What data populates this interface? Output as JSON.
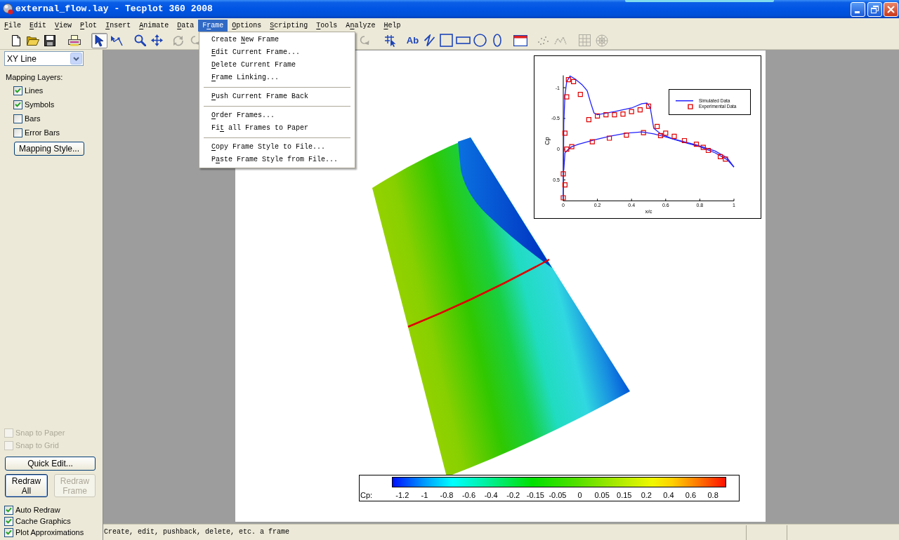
{
  "window": {
    "title": "external_flow.lay - Tecplot 360 2008"
  },
  "menu_bar": [
    {
      "underlined": "F",
      "after": "ile",
      "selected": false
    },
    {
      "underlined": "E",
      "after": "dit",
      "selected": false
    },
    {
      "underlined": "V",
      "after": "iew",
      "selected": false
    },
    {
      "underlined": "P",
      "after": "lot",
      "selected": false
    },
    {
      "underlined": "I",
      "after": "nsert",
      "selected": false
    },
    {
      "underlined": "A",
      "after": "nimate",
      "selected": false
    },
    {
      "underlined": "D",
      "after": "ata",
      "selected": false
    },
    {
      "before": "F",
      "underlined": "r",
      "after": "ame",
      "selected": true
    },
    {
      "underlined": "O",
      "after": "ptions",
      "selected": false
    },
    {
      "underlined": "S",
      "after": "cripting",
      "selected": false
    },
    {
      "underlined": "T",
      "after": "ools",
      "selected": false
    },
    {
      "before": "A",
      "underlined": "n",
      "after": "alyze",
      "selected": false
    },
    {
      "underlined": "H",
      "after": "elp",
      "selected": false
    }
  ],
  "toolbar": [
    {
      "tools": [
        {
          "kind": "new",
          "selected": false,
          "disabled": false
        },
        {
          "kind": "open",
          "selected": false,
          "disabled": false
        },
        {
          "kind": "save",
          "selected": false,
          "disabled": false
        }
      ]
    },
    {
      "tools": [
        {
          "kind": "print",
          "selected": false,
          "disabled": false
        }
      ]
    },
    {
      "tools": [
        {
          "kind": "pointer",
          "selected": true,
          "disabled": false
        },
        {
          "kind": "adjustor",
          "selected": false,
          "disabled": false
        }
      ]
    },
    {
      "tools": [
        {
          "kind": "zoom",
          "selected": false,
          "disabled": false
        },
        {
          "kind": "translate",
          "selected": false,
          "disabled": false
        }
      ]
    },
    {
      "tools": [
        {
          "kind": "rotate",
          "selected": false,
          "disabled": true
        },
        {
          "kind": "spin",
          "selected": false,
          "disabled": true
        }
      ]
    },
    {
      "tools": [
        {
          "kind": "spin",
          "selected": false,
          "disabled": true
        }
      ]
    },
    {
      "tools": [
        {
          "kind": "probe",
          "selected": false,
          "disabled": false
        }
      ]
    },
    {
      "tools": [
        {
          "kind": "text",
          "label": "Ab",
          "selected": false,
          "disabled": false
        },
        {
          "kind": "polyline",
          "selected": false,
          "disabled": false
        },
        {
          "kind": "square",
          "selected": false,
          "disabled": false
        },
        {
          "kind": "rectangle",
          "selected": false,
          "disabled": false
        },
        {
          "kind": "circle",
          "selected": false,
          "disabled": false
        },
        {
          "kind": "ellipse",
          "selected": false,
          "disabled": false
        }
      ]
    },
    {
      "tools": [
        {
          "kind": "frame",
          "selected": false,
          "disabled": false
        }
      ]
    },
    {
      "tools": [
        {
          "kind": "scatter",
          "selected": false,
          "disabled": true
        },
        {
          "kind": "line",
          "selected": false,
          "disabled": true
        }
      ]
    },
    {
      "tools": [
        {
          "kind": "grid",
          "selected": false,
          "disabled": true
        },
        {
          "kind": "polar",
          "selected": false,
          "disabled": true
        }
      ]
    }
  ],
  "sidebar": {
    "plot_type": {
      "value": "XY Line"
    },
    "mapping_layers": {
      "label": "Mapping Layers:",
      "items": [
        {
          "label": "Lines",
          "checked": true
        },
        {
          "label": "Symbols",
          "checked": true
        },
        {
          "label": "Bars",
          "checked": false
        },
        {
          "label": "Error Bars",
          "checked": false
        }
      ]
    },
    "mapping_style_button": {
      "label": "Mapping Style..."
    },
    "snap_options": [
      {
        "label": "Snap to Paper",
        "checked": false,
        "disabled": true
      },
      {
        "label": "Snap to Grid",
        "checked": false,
        "disabled": true
      }
    ],
    "quick_edit_button": {
      "label": "Quick Edit..."
    },
    "redraw_buttons": [
      {
        "label": "Redraw All",
        "disabled": false,
        "focused": true
      },
      {
        "label": "Redraw Frame",
        "disabled": true,
        "focused": false
      }
    ],
    "display_options": [
      {
        "label": "Auto Redraw",
        "checked": true
      },
      {
        "label": "Cache Graphics",
        "checked": true
      },
      {
        "label": "Plot Approximations",
        "checked": true
      }
    ]
  },
  "paper": {
    "xy_frame": {
      "chart_data": {
        "type": "line",
        "xlabel": "x/c",
        "ylabel": "Cp",
        "xlim": [
          0,
          1
        ],
        "ylim": [
          0.84,
          -1.2
        ],
        "xticks": [
          0,
          0.2,
          0.4,
          0.6,
          0.8,
          1
        ],
        "yticks": [
          -1,
          -0.5,
          0,
          0.5
        ],
        "legend": "upper right",
        "series": [
          {
            "name": "Simulated Data",
            "color": "#2020ff",
            "type": "line",
            "x": [
              0,
              0.003,
              0.01,
              0.02,
              0.04,
              0.07,
              0.11,
              0.14,
              0.16,
              0.18,
              0.2,
              0.3,
              0.4,
              0.46,
              0.49,
              0.51,
              0.53,
              0.57,
              0.64,
              0.78,
              0.89,
              0.96,
              1
            ],
            "values": [
              0.8,
              -0.42,
              -0.88,
              -1.1,
              -1.19,
              -1.14,
              -1.05,
              -0.95,
              -0.76,
              -0.59,
              -0.56,
              -0.61,
              -0.67,
              -0.74,
              -0.75,
              -0.67,
              -0.34,
              -0.25,
              -0.17,
              -0.07,
              0.03,
              0.14,
              0.29
            ]
          },
          {
            "color": "#2020ff",
            "type": "line",
            "x": [
              0.003,
              0.01,
              0.03,
              0.05,
              0.09,
              0.18,
              0.27,
              0.37,
              0.46,
              0.53,
              0.6,
              0.71,
              0.8,
              0.89,
              0.96,
              1
            ],
            "values": [
              0.34,
              0.06,
              0,
              -0.04,
              -0.08,
              -0.15,
              -0.21,
              -0.26,
              -0.28,
              -0.25,
              -0.2,
              -0.11,
              -0.04,
              0.06,
              0.17,
              0.29
            ]
          },
          {
            "name": "Experimental Data",
            "color": "#e00000",
            "type": "scatter",
            "x": [
              0,
              0.01,
              0,
              0.01,
              0.02,
              0.02,
              0.03,
              0.05,
              0.06,
              0.1,
              0.15,
              0.17,
              0.2,
              0.25,
              0.27,
              0.3,
              0.35,
              0.37,
              0.4,
              0.45,
              0.47,
              0.5,
              0.55,
              0.57,
              0.6,
              0.65,
              0.71,
              0.78,
              0.82,
              0.85,
              0.92,
              0.95
            ],
            "values": [
              0.79,
              0.58,
              0.4,
              -0.26,
              -0.85,
              0,
              -1.13,
              -0.04,
              -1.1,
              -0.89,
              -0.48,
              -0.12,
              -0.54,
              -0.56,
              -0.18,
              -0.56,
              -0.57,
              -0.23,
              -0.61,
              -0.64,
              -0.27,
              -0.7,
              -0.37,
              -0.22,
              -0.26,
              -0.21,
              -0.14,
              -0.08,
              -0.03,
              0.02,
              0.12,
              0.16
            ]
          }
        ]
      }
    },
    "contour_legend": {
      "variable": "Cp:",
      "levels": [
        "-1.2",
        "-1",
        "-0.8",
        "-0.6",
        "-0.4",
        "-0.2",
        "-0.15",
        "-0.05",
        "0",
        "0.05",
        "0.15",
        "0.2",
        "0.4",
        "0.6",
        "0.8"
      ]
    }
  },
  "frame_menu": {
    "groups": [
      [
        {
          "before": "Create ",
          "underlined": "N",
          "after": "ew Frame"
        },
        {
          "underlined": "E",
          "after": "dit Current Frame..."
        },
        {
          "underlined": "D",
          "after": "elete Current Frame"
        },
        {
          "underlined": "F",
          "after": "rame Linking..."
        }
      ],
      [
        {
          "underlined": "P",
          "after": "ush Current Frame Back"
        }
      ],
      [
        {
          "underlined": "O",
          "after": "rder Frames..."
        },
        {
          "before": "Fi",
          "underlined": "t",
          "after": " all Frames to Paper"
        }
      ],
      [
        {
          "underlined": "C",
          "after": "opy Frame Style to File..."
        },
        {
          "before": "P",
          "underlined": "a",
          "after": "ste Frame Style from File..."
        }
      ]
    ]
  },
  "status_bar": {
    "text": "Create, edit, pushback, delete, etc. a frame"
  }
}
